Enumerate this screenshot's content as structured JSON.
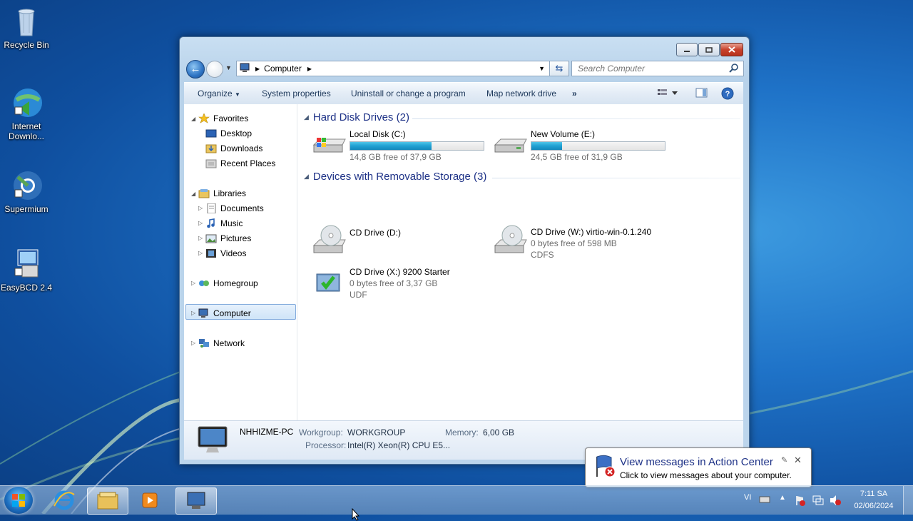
{
  "desktop": {
    "icons": [
      {
        "label": "Recycle Bin",
        "icon": "recycle-bin-icon"
      },
      {
        "label": "Internet Downlo...",
        "icon": "internet-download-manager-icon"
      },
      {
        "label": "Supermium",
        "icon": "supermium-icon"
      },
      {
        "label": "EasyBCD 2.4",
        "icon": "easybcd-icon"
      }
    ]
  },
  "window": {
    "address": {
      "location": "Computer"
    },
    "search": {
      "placeholder": "Search Computer"
    },
    "toolbar": {
      "organize": "Organize",
      "system_properties": "System properties",
      "uninstall": "Uninstall or change a program",
      "map_drive": "Map network drive",
      "more": "»"
    },
    "nav": {
      "favorites": "Favorites",
      "desktop": "Desktop",
      "downloads": "Downloads",
      "recent": "Recent Places",
      "libraries": "Libraries",
      "documents": "Documents",
      "music": "Music",
      "pictures": "Pictures",
      "videos": "Videos",
      "homegroup": "Homegroup",
      "computer": "Computer",
      "network": "Network"
    },
    "groups": {
      "hard_disks": "Hard Disk Drives (2)",
      "removable": "Devices with Removable Storage (3)"
    },
    "drives": {
      "c": {
        "name": "Local Disk (C:)",
        "free": "14,8 GB free of 37,9 GB",
        "used_fraction": 0.61
      },
      "e": {
        "name": "New Volume (E:)",
        "free": "24,5 GB free of 31,9 GB",
        "used_fraction": 0.23
      },
      "d": {
        "name": "CD Drive (D:)"
      },
      "w": {
        "name": "CD Drive (W:) virtio-win-0.1.240",
        "free": "0 bytes free of 598 MB",
        "fs": "CDFS"
      },
      "x": {
        "name": "CD Drive (X:) 9200 Starter",
        "free": "0 bytes free of 3,37 GB",
        "fs": "UDF"
      }
    },
    "details": {
      "pc_name": "NHHIZME-PC",
      "workgroup_label": "Workgroup:",
      "workgroup": "WORKGROUP",
      "memory_label": "Memory:",
      "memory": "6,00 GB",
      "processor_label": "Processor:",
      "processor": "Intel(R) Xeon(R) CPU E5..."
    }
  },
  "balloon": {
    "title": "View messages in Action Center",
    "body": "Click to view messages about your computer."
  },
  "taskbar": {
    "language": "VI",
    "time": "7:11 SA",
    "date": "02/06/2024"
  },
  "colors": {
    "accent": "#1e3287",
    "bar_fill": "#1fa0d2"
  }
}
